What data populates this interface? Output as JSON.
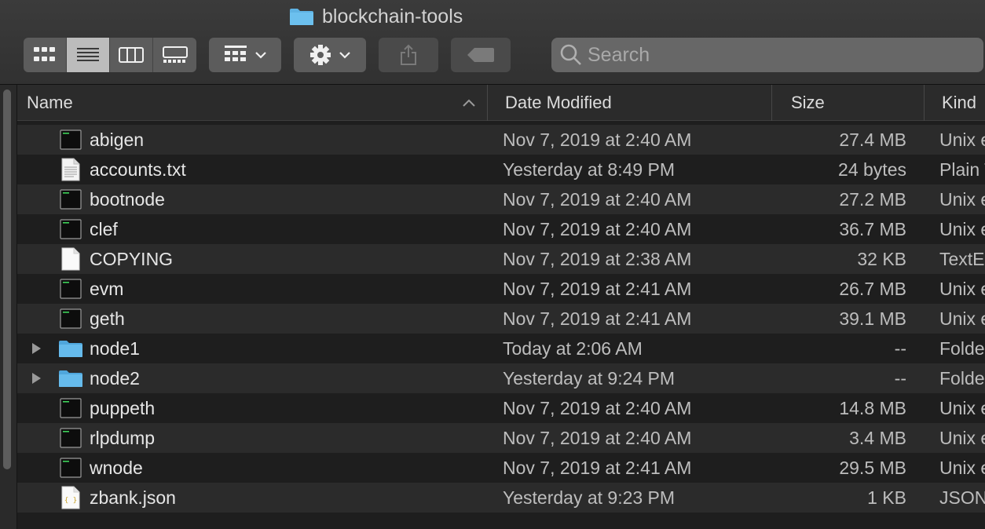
{
  "window": {
    "title": "blockchain-tools"
  },
  "toolbar": {
    "view_buttons": [
      {
        "icon": "icon-view-icon",
        "active": false
      },
      {
        "icon": "list-view-icon",
        "active": true
      },
      {
        "icon": "column-view-icon",
        "active": false
      },
      {
        "icon": "gallery-view-icon",
        "active": false
      }
    ],
    "group_icon": "group-by-icon",
    "action_icon": "gear-icon",
    "share_icon": "share-icon",
    "tag_icon": "tag-icon"
  },
  "search": {
    "placeholder": "Search",
    "value": ""
  },
  "columns": {
    "name": "Name",
    "date": "Date Modified",
    "size": "Size",
    "kind": "Kind"
  },
  "sort": {
    "column": "name",
    "direction": "ascending"
  },
  "files": [
    {
      "name": "abigen",
      "date": "Nov 7, 2019 at 2:40 AM",
      "size": "27.4 MB",
      "kind": "Unix executable",
      "icon": "terminal-exec-icon",
      "folder": false
    },
    {
      "name": "accounts.txt",
      "date": "Yesterday at 8:49 PM",
      "size": "24 bytes",
      "kind": "Plain Text",
      "icon": "text-document-icon",
      "folder": false
    },
    {
      "name": "bootnode",
      "date": "Nov 7, 2019 at 2:40 AM",
      "size": "27.2 MB",
      "kind": "Unix executable",
      "icon": "terminal-exec-icon",
      "folder": false
    },
    {
      "name": "clef",
      "date": "Nov 7, 2019 at 2:40 AM",
      "size": "36.7 MB",
      "kind": "Unix executable",
      "icon": "terminal-exec-icon",
      "folder": false
    },
    {
      "name": "COPYING",
      "date": "Nov 7, 2019 at 2:38 AM",
      "size": "32 KB",
      "kind": "TextEdit",
      "icon": "blank-document-icon",
      "folder": false
    },
    {
      "name": "evm",
      "date": "Nov 7, 2019 at 2:41 AM",
      "size": "26.7 MB",
      "kind": "Unix executable",
      "icon": "terminal-exec-icon",
      "folder": false
    },
    {
      "name": "geth",
      "date": "Nov 7, 2019 at 2:41 AM",
      "size": "39.1 MB",
      "kind": "Unix executable",
      "icon": "terminal-exec-icon",
      "folder": false
    },
    {
      "name": "node1",
      "date": "Today at 2:06 AM",
      "size": "--",
      "kind": "Folder",
      "icon": "folder-icon",
      "folder": true
    },
    {
      "name": "node2",
      "date": "Yesterday at 9:24 PM",
      "size": "--",
      "kind": "Folder",
      "icon": "folder-icon",
      "folder": true
    },
    {
      "name": "puppeth",
      "date": "Nov 7, 2019 at 2:40 AM",
      "size": "14.8 MB",
      "kind": "Unix executable",
      "icon": "terminal-exec-icon",
      "folder": false
    },
    {
      "name": "rlpdump",
      "date": "Nov 7, 2019 at 2:40 AM",
      "size": "3.4 MB",
      "kind": "Unix executable",
      "icon": "terminal-exec-icon",
      "folder": false
    },
    {
      "name": "wnode",
      "date": "Nov 7, 2019 at 2:41 AM",
      "size": "29.5 MB",
      "kind": "Unix executable",
      "icon": "terminal-exec-icon",
      "folder": false
    },
    {
      "name": "zbank.json",
      "date": "Yesterday at 9:23 PM",
      "size": "1 KB",
      "kind": "JSON",
      "icon": "json-document-icon",
      "folder": false
    }
  ],
  "colors": {
    "folder": "#5fb3e4",
    "accent": "#bcbcbc",
    "background": "#1e1e1e"
  }
}
